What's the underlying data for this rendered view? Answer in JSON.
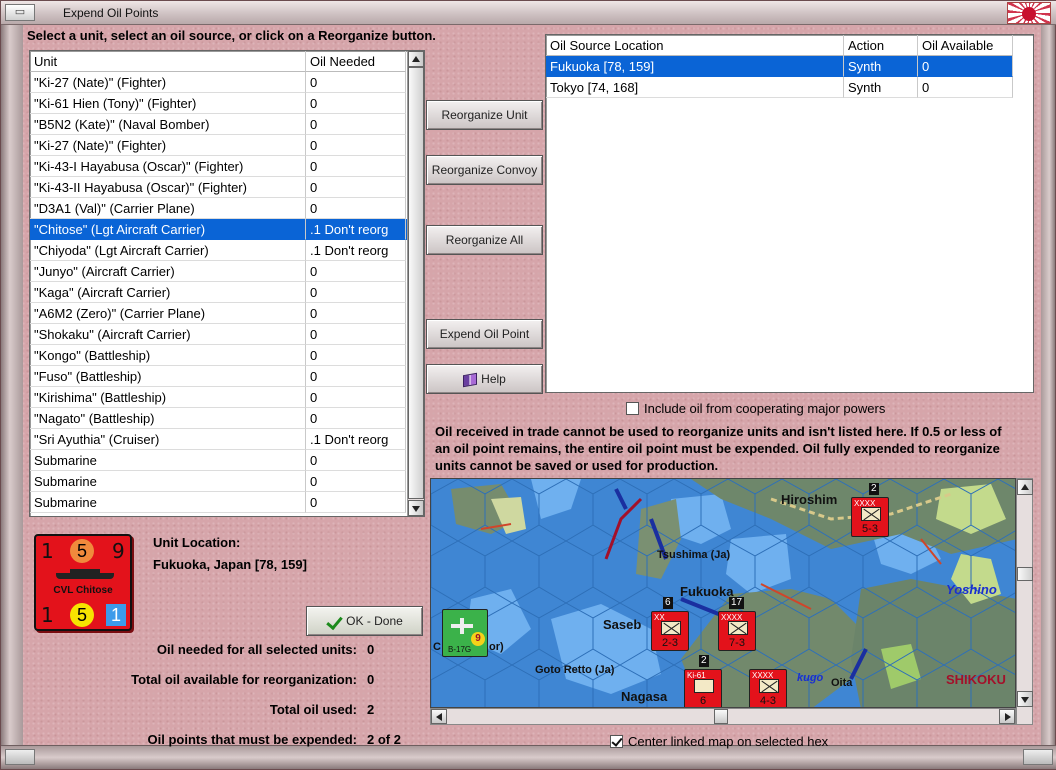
{
  "window": {
    "title": "Expend Oil Points"
  },
  "instruction": "Select a unit, select an oil source, or click on a Reorganize button.",
  "unit_table": {
    "columns": [
      "Unit",
      "Oil Needed"
    ],
    "rows": [
      {
        "unit": "\"Ki-27 (Nate)\" (Fighter)",
        "oil": "0"
      },
      {
        "unit": "\"Ki-61 Hien (Tony)\" (Fighter)",
        "oil": "0"
      },
      {
        "unit": "\"B5N2 (Kate)\" (Naval Bomber)",
        "oil": "0"
      },
      {
        "unit": "\"Ki-27 (Nate)\" (Fighter)",
        "oil": "0"
      },
      {
        "unit": "\"Ki-43-I Hayabusa (Oscar)\" (Fighter)",
        "oil": "0"
      },
      {
        "unit": "\"Ki-43-II Hayabusa (Oscar)\" (Fighter)",
        "oil": "0"
      },
      {
        "unit": "\"D3A1 (Val)\" (Carrier Plane)",
        "oil": "0"
      },
      {
        "unit": "\"Chitose\" (Lgt Aircraft Carrier)",
        "oil": ".1 Don't reorg"
      },
      {
        "unit": "\"Chiyoda\" (Lgt Aircraft Carrier)",
        "oil": ".1 Don't reorg"
      },
      {
        "unit": "\"Junyo\" (Aircraft Carrier)",
        "oil": "0"
      },
      {
        "unit": "\"Kaga\" (Aircraft Carrier)",
        "oil": "0"
      },
      {
        "unit": "\"A6M2 (Zero)\" (Carrier Plane)",
        "oil": "0"
      },
      {
        "unit": "\"Shokaku\" (Aircraft Carrier)",
        "oil": "0"
      },
      {
        "unit": "\"Kongo\" (Battleship)",
        "oil": "0"
      },
      {
        "unit": "\"Fuso\" (Battleship)",
        "oil": "0"
      },
      {
        "unit": "\"Kirishima\" (Battleship)",
        "oil": "0"
      },
      {
        "unit": "\"Nagato\" (Battleship)",
        "oil": "0"
      },
      {
        "unit": "\"Sri Ayuthia\" (Cruiser)",
        "oil": ".1 Don't reorg"
      },
      {
        "unit": "Submarine",
        "oil": "0"
      },
      {
        "unit": "Submarine",
        "oil": "0"
      },
      {
        "unit": "Submarine",
        "oil": "0"
      }
    ],
    "selected_index": 7
  },
  "oil_source_table": {
    "columns": [
      "Oil Source Location",
      "Action",
      "Oil Available"
    ],
    "rows": [
      {
        "location": "Fukuoka [78, 159]",
        "action": "Synth",
        "available": "0"
      },
      {
        "location": "Tokyo [74, 168]",
        "action": "Synth",
        "available": "0"
      }
    ],
    "selected_index": 0
  },
  "buttons": {
    "reorganize_unit": "Reorganize Unit",
    "reorganize_convoy": "Reorganize Convoy",
    "reorganize_all": "Reorganize All",
    "expend_oil_point": "Expend Oil Point",
    "help": "Help",
    "ok_done": "OK - Done"
  },
  "unit_counter": {
    "top_left": "1",
    "top_mid": "5",
    "top_right": "9",
    "name": "CVL Chitose",
    "bottom_left": "1",
    "bottom_mid": "5",
    "bottom_right": "1",
    "colors": {
      "background": "#e3121b",
      "top_circle": "#f08a3c",
      "bottom_circle": "#f7e400",
      "box": "#3d9bea"
    }
  },
  "location": {
    "label": "Unit Location:",
    "value": "Fukuoka, Japan [78, 159]"
  },
  "stats": {
    "oil_needed_label": "Oil needed for all selected units:",
    "oil_needed_value": "0",
    "total_available_label": "Total oil available for reorganization:",
    "total_available_value": "0",
    "total_used_label": "Total oil used:",
    "total_used_value": "2",
    "must_expend_label": "Oil points that must be expended:",
    "must_expend_value": "2 of 2"
  },
  "include_cooperating": {
    "label": "Include oil from cooperating major powers",
    "checked": false
  },
  "info_text": "Oil received in trade cannot be used to reorganize units and isn't listed here.  If 0.5 or less of an oil point remains, the entire oil point must be expended.   Oil fully expended to reorganize units cannot be saved or used for production.",
  "center_map": {
    "label": "Center linked map on selected hex",
    "checked": true
  },
  "map": {
    "labels": {
      "hiroshima": "Hiroshim",
      "tsushima": "Tsushima (Ja)",
      "fukuoka": "Fukuoka",
      "sasebo": "Saseb",
      "goto_retto": "Goto Retto (Ja)",
      "nagasaki": "Nagasa",
      "yoshino": "Yoshino",
      "shikoku": "SHIKOKU",
      "oita": "Oita",
      "kugo": "kugo",
      "or": "or)",
      "c": "C"
    },
    "counters": [
      {
        "id": "hiroshima-corps",
        "value": "5-3",
        "badge": "2",
        "top": "XXXX"
      },
      {
        "id": "fukuoka-army-a",
        "value": "2-3",
        "badge": "6",
        "top": "XX"
      },
      {
        "id": "fukuoka-army-b",
        "value": "7-3",
        "badge": "17",
        "top": "XXXX"
      },
      {
        "id": "nagasaki-unit",
        "value": "6",
        "badge": "2",
        "top": "Ki-61"
      },
      {
        "id": "oita-army",
        "value": "4-3",
        "badge": "",
        "top": "XXXX"
      }
    ],
    "air_unit": {
      "label": "B-17G",
      "coin": "9"
    },
    "colors": {
      "sea": "#3f86d3",
      "land": "#6f8a6a",
      "hex_fill": "#6fb0ef"
    }
  }
}
